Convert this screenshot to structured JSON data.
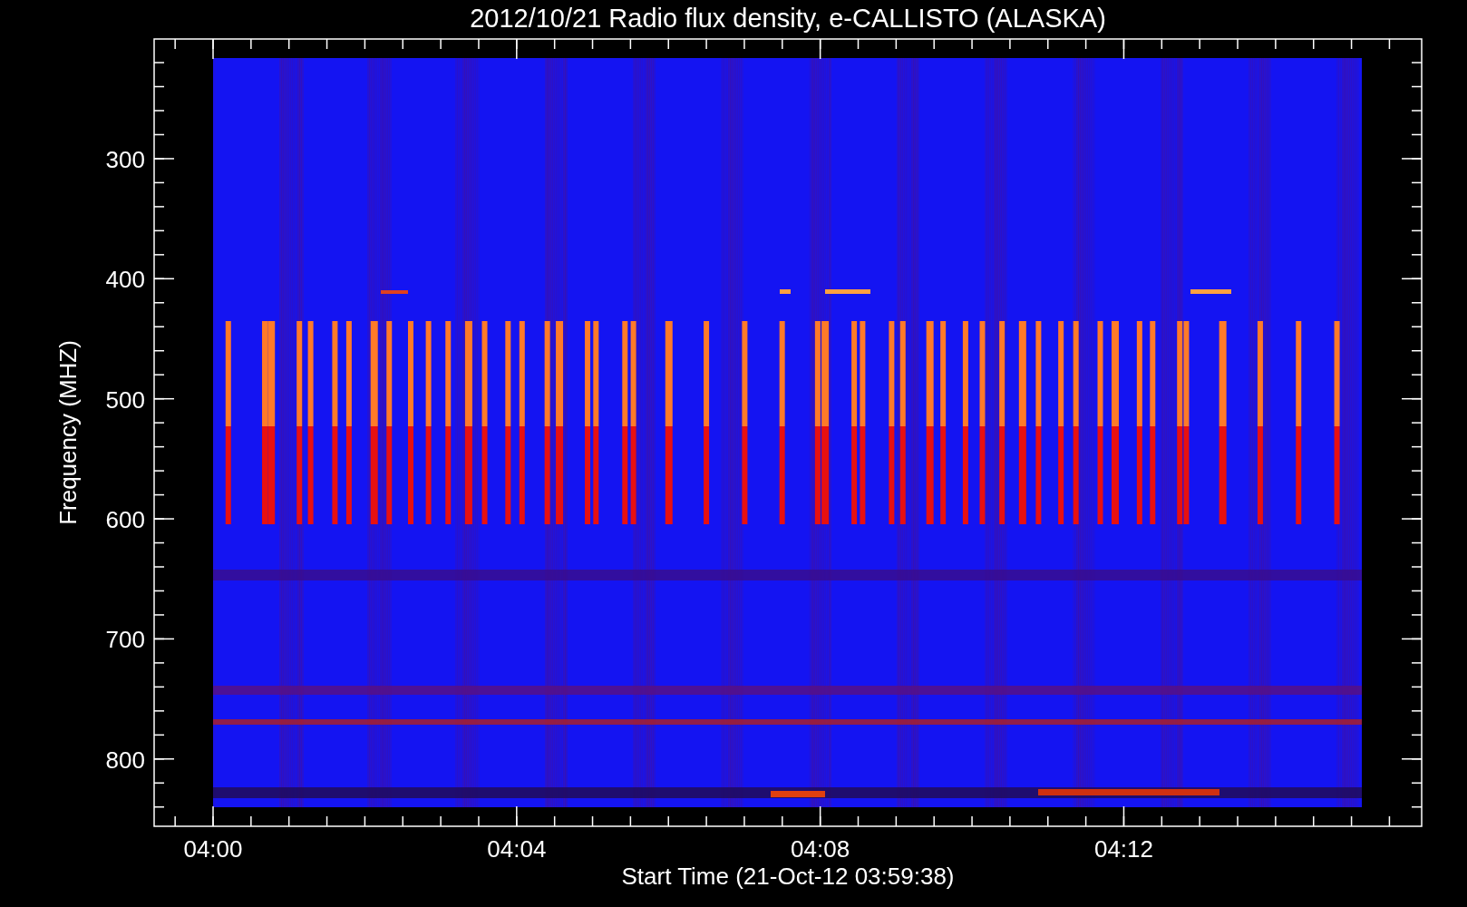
{
  "title": "2012/10/21  Radio flux density, e-CALLISTO (ALASKA)",
  "y_axis": {
    "label": "Frequency (MHZ)",
    "ticks": [
      "300",
      "400",
      "500",
      "600",
      "700",
      "800"
    ]
  },
  "x_axis": {
    "label": "Start Time (21-Oct-12 03:59:38)",
    "ticks": [
      "04:00",
      "04:04",
      "04:08",
      "04:12"
    ]
  }
}
